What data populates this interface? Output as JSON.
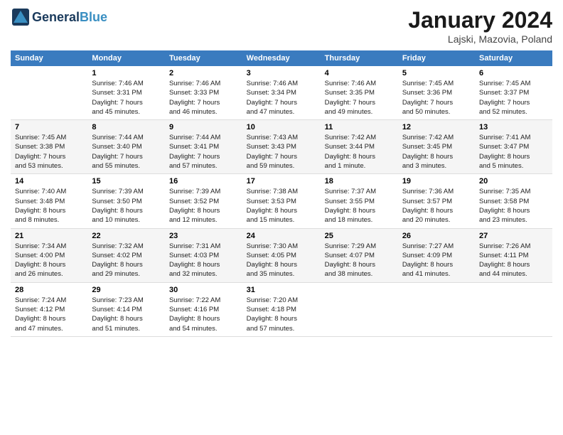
{
  "header": {
    "logo_general": "General",
    "logo_blue": "Blue",
    "title": "January 2024",
    "subtitle": "Lajski, Mazovia, Poland"
  },
  "days_of_week": [
    "Sunday",
    "Monday",
    "Tuesday",
    "Wednesday",
    "Thursday",
    "Friday",
    "Saturday"
  ],
  "weeks": [
    [
      {
        "day": "",
        "info": ""
      },
      {
        "day": "1",
        "info": "Sunrise: 7:46 AM\nSunset: 3:31 PM\nDaylight: 7 hours\nand 45 minutes."
      },
      {
        "day": "2",
        "info": "Sunrise: 7:46 AM\nSunset: 3:33 PM\nDaylight: 7 hours\nand 46 minutes."
      },
      {
        "day": "3",
        "info": "Sunrise: 7:46 AM\nSunset: 3:34 PM\nDaylight: 7 hours\nand 47 minutes."
      },
      {
        "day": "4",
        "info": "Sunrise: 7:46 AM\nSunset: 3:35 PM\nDaylight: 7 hours\nand 49 minutes."
      },
      {
        "day": "5",
        "info": "Sunrise: 7:45 AM\nSunset: 3:36 PM\nDaylight: 7 hours\nand 50 minutes."
      },
      {
        "day": "6",
        "info": "Sunrise: 7:45 AM\nSunset: 3:37 PM\nDaylight: 7 hours\nand 52 minutes."
      }
    ],
    [
      {
        "day": "7",
        "info": "Sunrise: 7:45 AM\nSunset: 3:38 PM\nDaylight: 7 hours\nand 53 minutes."
      },
      {
        "day": "8",
        "info": "Sunrise: 7:44 AM\nSunset: 3:40 PM\nDaylight: 7 hours\nand 55 minutes."
      },
      {
        "day": "9",
        "info": "Sunrise: 7:44 AM\nSunset: 3:41 PM\nDaylight: 7 hours\nand 57 minutes."
      },
      {
        "day": "10",
        "info": "Sunrise: 7:43 AM\nSunset: 3:43 PM\nDaylight: 7 hours\nand 59 minutes."
      },
      {
        "day": "11",
        "info": "Sunrise: 7:42 AM\nSunset: 3:44 PM\nDaylight: 8 hours\nand 1 minute."
      },
      {
        "day": "12",
        "info": "Sunrise: 7:42 AM\nSunset: 3:45 PM\nDaylight: 8 hours\nand 3 minutes."
      },
      {
        "day": "13",
        "info": "Sunrise: 7:41 AM\nSunset: 3:47 PM\nDaylight: 8 hours\nand 5 minutes."
      }
    ],
    [
      {
        "day": "14",
        "info": "Sunrise: 7:40 AM\nSunset: 3:48 PM\nDaylight: 8 hours\nand 8 minutes."
      },
      {
        "day": "15",
        "info": "Sunrise: 7:39 AM\nSunset: 3:50 PM\nDaylight: 8 hours\nand 10 minutes."
      },
      {
        "day": "16",
        "info": "Sunrise: 7:39 AM\nSunset: 3:52 PM\nDaylight: 8 hours\nand 12 minutes."
      },
      {
        "day": "17",
        "info": "Sunrise: 7:38 AM\nSunset: 3:53 PM\nDaylight: 8 hours\nand 15 minutes."
      },
      {
        "day": "18",
        "info": "Sunrise: 7:37 AM\nSunset: 3:55 PM\nDaylight: 8 hours\nand 18 minutes."
      },
      {
        "day": "19",
        "info": "Sunrise: 7:36 AM\nSunset: 3:57 PM\nDaylight: 8 hours\nand 20 minutes."
      },
      {
        "day": "20",
        "info": "Sunrise: 7:35 AM\nSunset: 3:58 PM\nDaylight: 8 hours\nand 23 minutes."
      }
    ],
    [
      {
        "day": "21",
        "info": "Sunrise: 7:34 AM\nSunset: 4:00 PM\nDaylight: 8 hours\nand 26 minutes."
      },
      {
        "day": "22",
        "info": "Sunrise: 7:32 AM\nSunset: 4:02 PM\nDaylight: 8 hours\nand 29 minutes."
      },
      {
        "day": "23",
        "info": "Sunrise: 7:31 AM\nSunset: 4:03 PM\nDaylight: 8 hours\nand 32 minutes."
      },
      {
        "day": "24",
        "info": "Sunrise: 7:30 AM\nSunset: 4:05 PM\nDaylight: 8 hours\nand 35 minutes."
      },
      {
        "day": "25",
        "info": "Sunrise: 7:29 AM\nSunset: 4:07 PM\nDaylight: 8 hours\nand 38 minutes."
      },
      {
        "day": "26",
        "info": "Sunrise: 7:27 AM\nSunset: 4:09 PM\nDaylight: 8 hours\nand 41 minutes."
      },
      {
        "day": "27",
        "info": "Sunrise: 7:26 AM\nSunset: 4:11 PM\nDaylight: 8 hours\nand 44 minutes."
      }
    ],
    [
      {
        "day": "28",
        "info": "Sunrise: 7:24 AM\nSunset: 4:12 PM\nDaylight: 8 hours\nand 47 minutes."
      },
      {
        "day": "29",
        "info": "Sunrise: 7:23 AM\nSunset: 4:14 PM\nDaylight: 8 hours\nand 51 minutes."
      },
      {
        "day": "30",
        "info": "Sunrise: 7:22 AM\nSunset: 4:16 PM\nDaylight: 8 hours\nand 54 minutes."
      },
      {
        "day": "31",
        "info": "Sunrise: 7:20 AM\nSunset: 4:18 PM\nDaylight: 8 hours\nand 57 minutes."
      },
      {
        "day": "",
        "info": ""
      },
      {
        "day": "",
        "info": ""
      },
      {
        "day": "",
        "info": ""
      }
    ]
  ]
}
